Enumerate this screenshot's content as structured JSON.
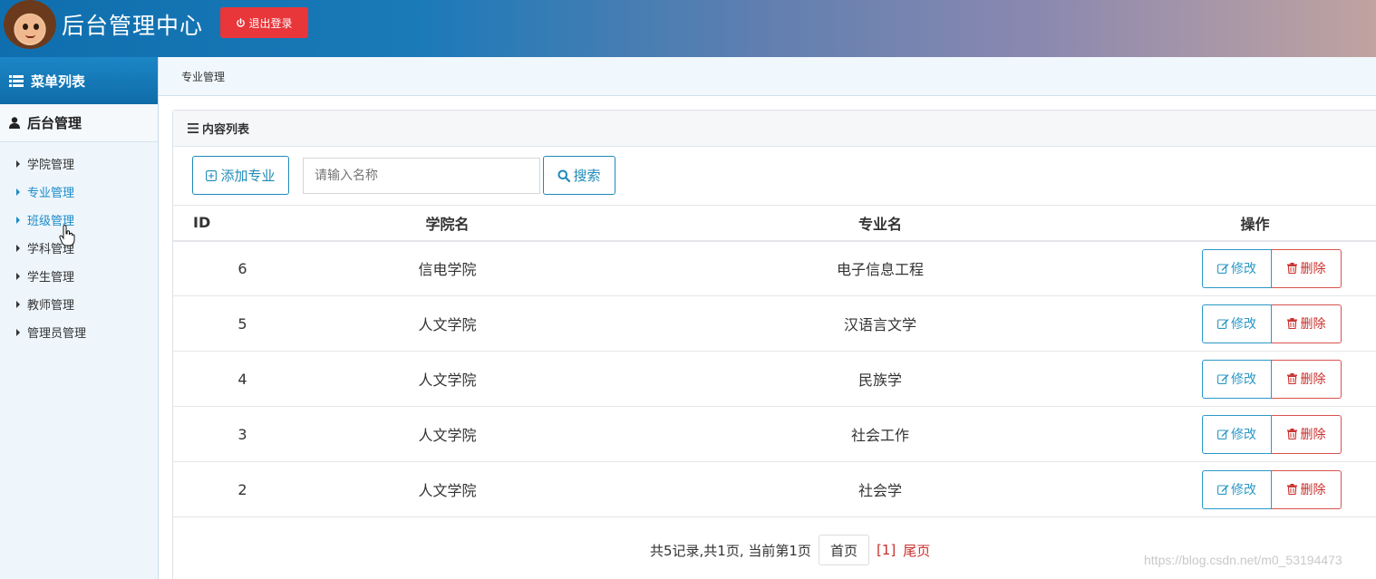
{
  "header": {
    "title": "后台管理中心",
    "logout_label": "退出登录",
    "avatar_icon": "cartoon-avatar",
    "logout_color": "#e8363b"
  },
  "sidebar": {
    "menu_title": "菜单列表",
    "group_title": "后台管理",
    "items": [
      {
        "label": "学院管理"
      },
      {
        "label": "专业管理"
      },
      {
        "label": "班级管理"
      },
      {
        "label": "学科管理"
      },
      {
        "label": "学生管理"
      },
      {
        "label": "教师管理"
      },
      {
        "label": "管理员管理"
      }
    ],
    "active_index": 1
  },
  "breadcrumb": {
    "current": "专业管理"
  },
  "panel": {
    "title": "内容列表",
    "add_label": "添加专业",
    "search_placeholder": "请输入名称",
    "search_label": "搜索"
  },
  "table": {
    "columns": [
      "ID",
      "学院名",
      "专业名",
      "操作"
    ],
    "rows": [
      {
        "id": "6",
        "college": "信电学院",
        "major": "电子信息工程"
      },
      {
        "id": "5",
        "college": "人文学院",
        "major": "汉语言文学"
      },
      {
        "id": "4",
        "college": "人文学院",
        "major": "民族学"
      },
      {
        "id": "3",
        "college": "人文学院",
        "major": "社会工作"
      },
      {
        "id": "2",
        "college": "人文学院",
        "major": "社会学"
      }
    ],
    "edit_label": "修改",
    "delete_label": "删除"
  },
  "pager": {
    "summary": "共5记录,共1页, 当前第1页",
    "first_label": "首页",
    "current_page": "[1]",
    "last_label": "尾页"
  },
  "watermark": "https://blog.csdn.net/m0_53194473"
}
